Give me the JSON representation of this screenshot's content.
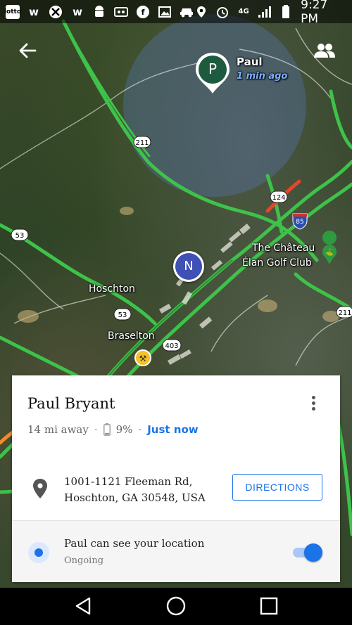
{
  "status_bar": {
    "time": "9:27 PM",
    "left_icons": [
      "lotto-app-icon",
      "words-app-icon",
      "xbox-icon",
      "words-app-icon-2",
      "android-icon",
      "voicemail-icon",
      "fantasy-app-icon",
      "image-icon",
      "car-icon"
    ],
    "right_icons": [
      "location-icon",
      "alarm-icon",
      "4g-icon",
      "signal-icon",
      "battery-icon"
    ],
    "tiles": {
      "lotto": "lotto"
    },
    "network": "4G"
  },
  "map": {
    "friend_avatar_letter": "P",
    "friend_label": "Paul",
    "friend_time": "1 min ago",
    "self_avatar_letter": "N",
    "places": {
      "hoschton": "Hoschton",
      "braselton": "Braselton",
      "chateau_line1": "The Château",
      "chateau_line2": "Élan Golf Club"
    },
    "route_shields": {
      "r211": "211",
      "r124": "124",
      "r85": "85",
      "r53a": "53",
      "r53b": "53",
      "r403": "403",
      "r211b": "211"
    }
  },
  "card": {
    "name": "Paul Bryant",
    "distance": "14 mi away",
    "battery": "9%",
    "updated": "Just now",
    "separator": "·",
    "address_line1": "1001-1121 Fleeman Rd,",
    "address_line2": "Hoschton, GA 30548, USA",
    "directions_label": "DIRECTIONS",
    "share_title": "Paul can see your location",
    "share_status": "Ongoing",
    "share_enabled": true
  },
  "colors": {
    "accent": "#1a73e8",
    "friend_marker": "#1e5a3e",
    "self_marker": "#3f51b5",
    "road_highway": "#3ec24a",
    "road_congested": "#e8442a"
  }
}
